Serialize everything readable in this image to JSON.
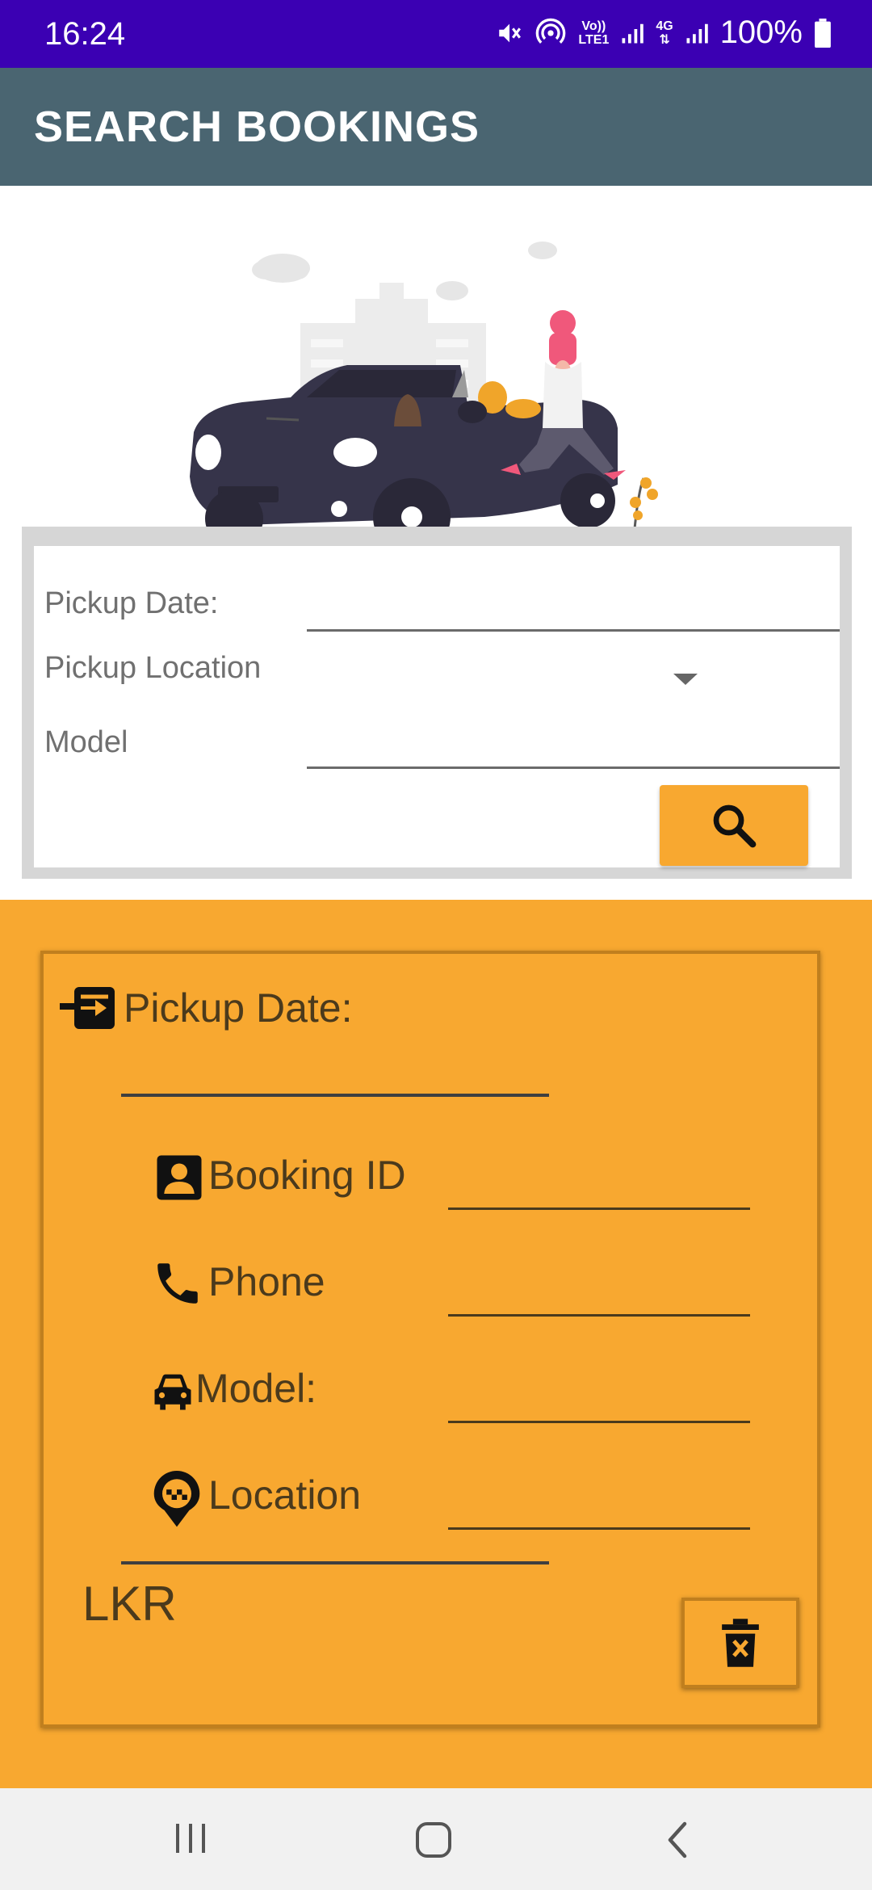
{
  "status_bar": {
    "time": "16:24",
    "battery": "100%",
    "icons": [
      "mute-icon",
      "hotspot-icon",
      "volte-icon",
      "signal-icon",
      "4g-icon",
      "signal-icon",
      "battery-icon"
    ],
    "volte_label_1": "Vo))",
    "volte_label_2": "LTE1",
    "net_label": "4G"
  },
  "app_bar": {
    "title": "SEARCH BOOKINGS",
    "color": "#4a6571"
  },
  "search_form": {
    "pickup_date_label": "Pickup Date:",
    "pickup_location_label": "Pickup Location",
    "model_label": "Model",
    "search_button_icon": "search-icon",
    "accent": "#f8a830"
  },
  "result": {
    "pickup_date_label": "Pickup Date:",
    "booking_id_label": "Booking ID",
    "phone_label": "Phone",
    "model_label": "Model:",
    "location_label": "Location",
    "currency": "LKR",
    "delete_icon": "delete-icon",
    "background": "#f8a830"
  },
  "nav_bar": {
    "buttons": [
      "recent-apps-icon",
      "home-icon",
      "back-icon"
    ]
  }
}
